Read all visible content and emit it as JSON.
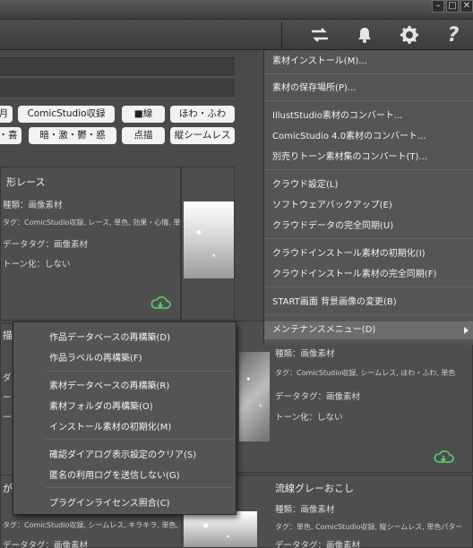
{
  "toolbar": {
    "icons": [
      "swap-icon",
      "bell-icon",
      "gear-icon",
      "help-icon"
    ]
  },
  "tags": {
    "row1": [
      "月",
      "ComicStudio収録",
      "■線",
      "ほわ・ふわ"
    ],
    "row2": [
      "・喜",
      "暗・激・鬱・惑",
      "点描",
      "縦シームレス"
    ]
  },
  "cards": {
    "top": {
      "title": "形レース",
      "kind": "種類：画像素材",
      "tags": "タグ：ComicStudio収録, レース, 単色, 効果・心情, 単色",
      "datatag": "データタグ：画像素材",
      "tone": "トーン化：しない"
    },
    "right": {
      "kind": "種類：画像素材",
      "tags": "タグ：ComicStudio収録, シームレス, ほわ・ふわ, 単色",
      "datatag": "データタグ：画像素材",
      "tone": "トーン化：しない"
    },
    "bottom_right": {
      "title": "流線グレーおこし",
      "kind": "種類：画像素材",
      "tags": "タグ：単色, ComicStudio収録, 縦シームレス, 単色パター",
      "datatag": "データタグ：画像素材"
    },
    "bottom_left": {
      "title": "が",
      "tags": "タグ：ComicStudio収録, シームレス, キラキラ, 単色, 効",
      "datatag": "データタグ：画像素材"
    },
    "left_fragments": [
      "描",
      "ダ",
      "ー",
      "一",
      "ト"
    ]
  },
  "main_menu": {
    "items": [
      "素材インストール(M)...",
      "素材の保存場所(P)...",
      "IllustStudio素材のコンバート...",
      "ComicStudio 4.0素材のコンバート...",
      "別売りトーン素材集のコンバート(T)...",
      "クラウド設定(L)",
      "ソフトウェアバックアップ(E)",
      "クラウドデータの完全同期(U)",
      "クラウドインストール素材の初期化(I)",
      "クラウドインストール素材の完全同期(F)",
      "START画面 背景画像の変更(B)",
      "メンテナンスメニュー(D)"
    ]
  },
  "sub_menu": {
    "items": [
      "作品データベースの再構築(D)",
      "作品ラベルの再構築(F)",
      "素材データベースの再構築(R)",
      "素材フォルダの再構築(O)",
      "インストール素材の初期化(M)",
      "確認ダイアログ表示設定のクリア(S)",
      "匿名の利用ログを送信しない(G)",
      "プラグインライセンス照合(C)"
    ]
  }
}
